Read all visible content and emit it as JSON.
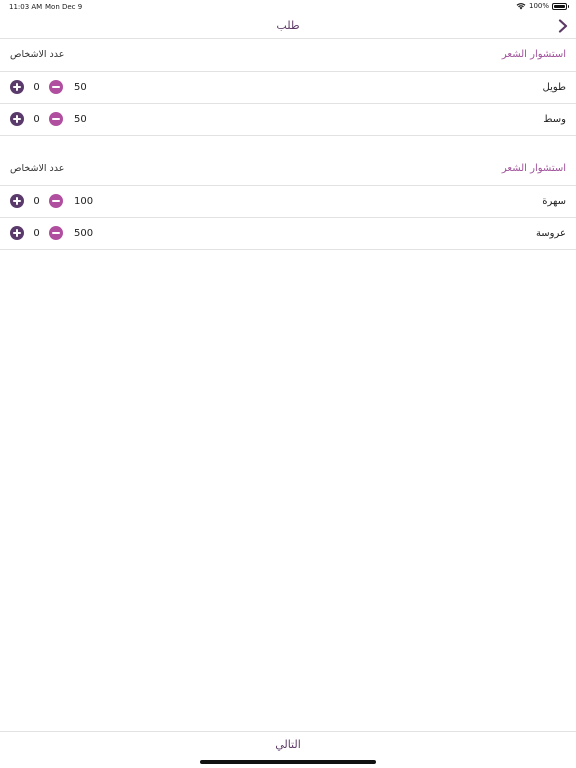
{
  "status_bar": {
    "time": "11:03 AM",
    "date": "Mon Dec 9",
    "battery": "100%"
  },
  "nav": {
    "title": "طلب"
  },
  "sections": [
    {
      "service_label": "استشوار الشعر",
      "count_label": "عدد الاشخاص",
      "items": [
        {
          "name": "طويل",
          "price": "50",
          "quantity": "0"
        },
        {
          "name": "وسط",
          "price": "50",
          "quantity": "0"
        }
      ]
    },
    {
      "service_label": "استشوار الشعر",
      "count_label": "عدد الاشخاص",
      "items": [
        {
          "name": "سهرة",
          "price": "100",
          "quantity": "0"
        },
        {
          "name": "عروسة",
          "price": "500",
          "quantity": "0"
        }
      ]
    }
  ],
  "footer": {
    "next_label": "التالي"
  },
  "colors": {
    "accent": "#5c3a66",
    "plus": "#5a3a6b",
    "minus": "#b04e9f",
    "section_label": "#a0519a"
  },
  "icons": {
    "back": "chevron-right-icon",
    "wifi": "wifi-icon",
    "battery": "battery-icon"
  }
}
